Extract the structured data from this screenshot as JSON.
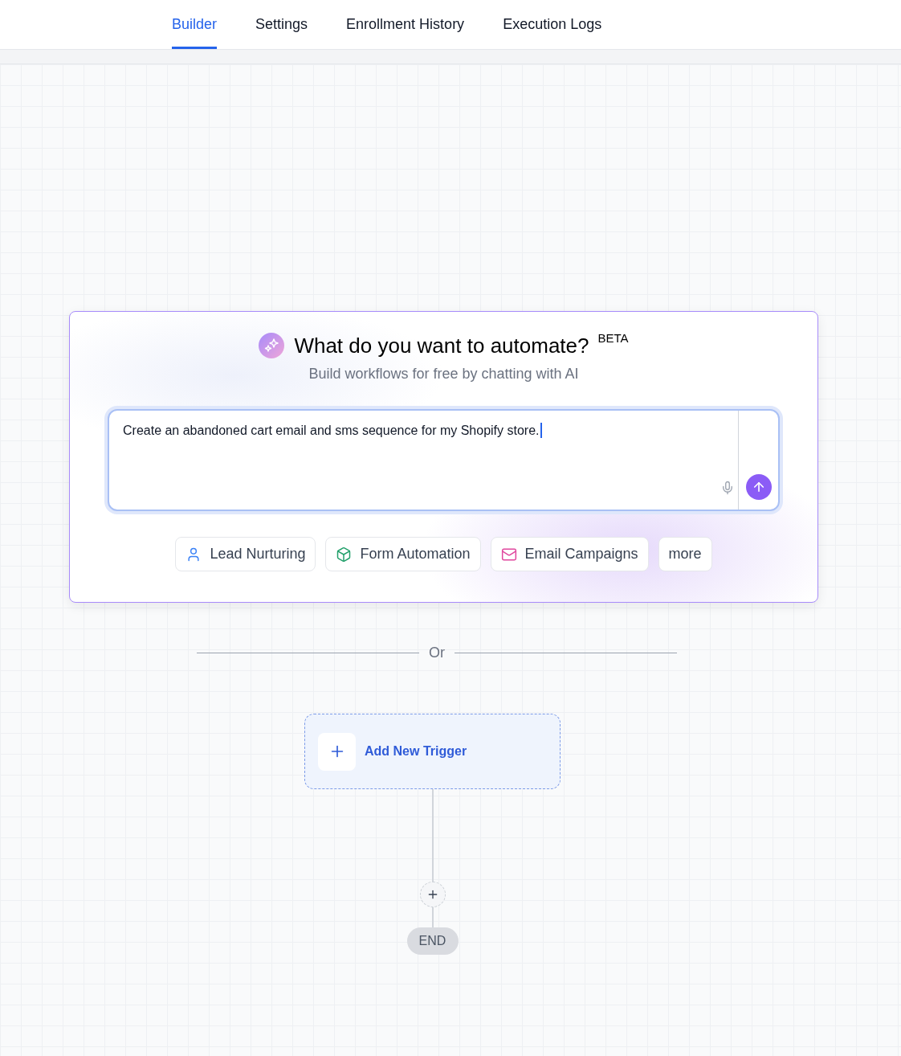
{
  "tabs": [
    {
      "label": "Builder",
      "selected": true
    },
    {
      "label": "Settings",
      "selected": false
    },
    {
      "label": "Enrollment History",
      "selected": false
    },
    {
      "label": "Execution Logs",
      "selected": false
    }
  ],
  "ai_prompt": {
    "title": "What do you want to automate?",
    "badge": "BETA",
    "subtitle": "Build workflows for free by chatting with AI",
    "input": {
      "value": "Create an abandoned cart email and sms sequence for my Shopify store."
    },
    "suggestions": [
      {
        "kind": "person",
        "label": "Lead Nurturing"
      },
      {
        "kind": "box",
        "label": "Form Automation"
      },
      {
        "kind": "mail",
        "label": "Email Campaigns"
      },
      {
        "kind": "plain",
        "label": "more"
      }
    ]
  },
  "divider": {
    "label": "Or"
  },
  "flow": {
    "trigger": {
      "label": "Add New Trigger"
    },
    "end": {
      "label": "END"
    }
  }
}
